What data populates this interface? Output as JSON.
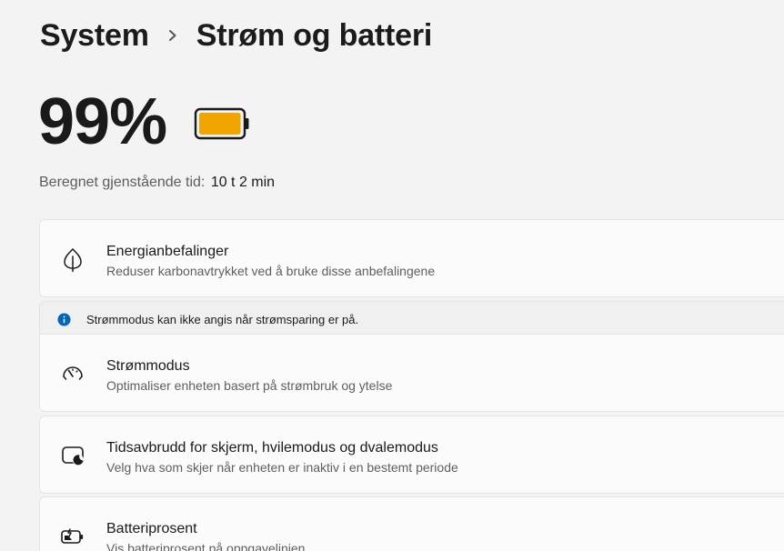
{
  "breadcrumb": {
    "parent": "System",
    "separator_icon": "chevron-right-icon",
    "current": "Strøm og batteri"
  },
  "battery": {
    "percent_text": "99%",
    "level": 0.99,
    "icon": "battery-icon",
    "fill_color": "#f0a500"
  },
  "remaining": {
    "label": "Beregnet gjenstående tid:",
    "value": "10 t 2 min"
  },
  "cards": [
    {
      "icon": "leaf-icon",
      "title": "Energianbefalinger",
      "subtitle": "Reduser karbonavtrykket ved å bruke disse anbefalingene"
    },
    {
      "icon": "power-mode-gauge-icon",
      "title": "Strømmodus",
      "subtitle": "Optimaliser enheten basert på strømbruk og ytelse"
    },
    {
      "icon": "screen-sleep-icon",
      "title": "Tidsavbrudd for skjerm, hvilemodus og dvalemodus",
      "subtitle": "Velg hva som skjer når enheten er inaktiv i en bestemt periode"
    },
    {
      "icon": "battery-saver-icon",
      "title": "Batteriprosent",
      "subtitle": "Vis batteriprosent på oppgavelinjen"
    }
  ],
  "info_bar": {
    "icon": "info-icon",
    "text": "Strømmodus kan ikke angis når strømsparing er på.",
    "accent": "#0067c0"
  }
}
